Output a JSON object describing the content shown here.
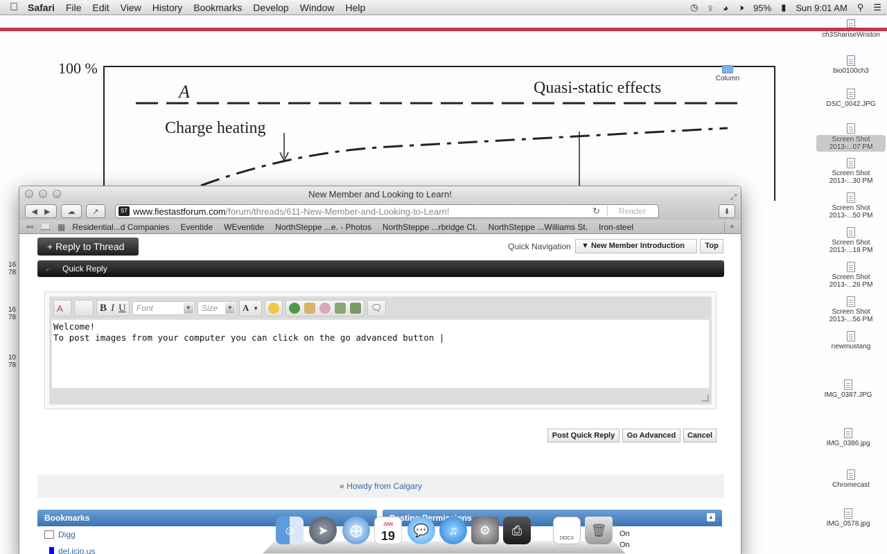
{
  "menubar": {
    "app_name": "Safari",
    "menus": [
      "File",
      "Edit",
      "View",
      "History",
      "Bookmarks",
      "Develop",
      "Window",
      "Help"
    ],
    "battery": "95%",
    "clock": "Sun 9:01 AM"
  },
  "figure": {
    "y_label": "100 %",
    "label_a": "A",
    "label_quasi": "Quasi-static effects",
    "label_charge": "Charge heating"
  },
  "side_numbers": [
    "16",
    "78",
    "16",
    "78",
    "10",
    "78"
  ],
  "desktop_icons": [
    {
      "label": "ch3ShariseWriston"
    },
    {
      "label": "bio0100ch3"
    },
    {
      "label": "Column"
    },
    {
      "label": "DSC_0042.JPG"
    },
    {
      "label": "Screen Shot 2013-...07 PM"
    },
    {
      "label": "Screen Shot 2013-...30 PM"
    },
    {
      "label": "Screen Shot 2013-...50 PM"
    },
    {
      "label": "Screen Shot 2013-...18 PM"
    },
    {
      "label": "Screen Shot 2013-...26 PM"
    },
    {
      "label": "Screen Shot 2013-...56 PM"
    },
    {
      "label": "newmustang"
    },
    {
      "label": "IMG_0387.JPG"
    },
    {
      "label": "IMG_0386.jpg"
    },
    {
      "label": "Chromecast"
    },
    {
      "label": "IMG_0578.jpg"
    }
  ],
  "window": {
    "title": "New Member and Looking to Learn!",
    "url_host": "www.fiestastforum.com",
    "url_path": "/forum/threads/611-New-Member-and-Looking-to-Learn!",
    "reader_label": "Reader",
    "favicon_text": "ST"
  },
  "bookmarks_bar": [
    "Residential...d Companies",
    "Eventide",
    "WEventide",
    "NorthSteppe ...e. - Photos",
    "NorthSteppe ...rbridge Ct.",
    "NorthSteppe ...Williams St.",
    "Iron-steel"
  ],
  "forum": {
    "reply_to_thread": "+ Reply to Thread",
    "quick_navigation_label": "Quick Navigation",
    "quick_navigation_value": "New Member Introduction",
    "top_label": "Top",
    "quick_reply_title": "Quick Reply",
    "font_placeholder": "Font",
    "size_placeholder": "Size",
    "editor_text": "Welcome!\nTo post images from your computer you can click on the go advanced button |",
    "post_quick_reply": "Post Quick Reply",
    "go_advanced": "Go Advanced",
    "cancel": "Cancel",
    "prev_thread_prefix": "«",
    "prev_thread_link": "Howdy from Calgary",
    "bookmarks_heading": "Bookmarks",
    "posting_permissions_heading": "Posting Permissions",
    "bookmark_links": [
      "Digg",
      "del.icio.us"
    ],
    "perm_on_1": "On",
    "perm_on_2": "On"
  },
  "dock": {
    "calendar_month": "JAN",
    "calendar_day": "19",
    "docx_label": "DOCX"
  }
}
